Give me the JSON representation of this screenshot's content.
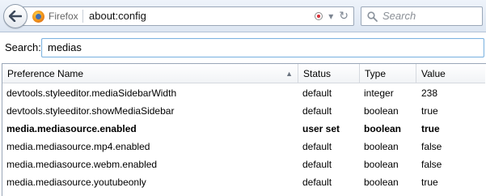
{
  "browser": {
    "identity_label": "Firefox",
    "url": "about:config",
    "search_placeholder": "Search"
  },
  "filter": {
    "label": "Search:",
    "value": "medias"
  },
  "table": {
    "columns": [
      "Preference Name",
      "Status",
      "Type",
      "Value"
    ],
    "sorted_column": "Preference Name",
    "sort_direction": "ascending",
    "rows": [
      {
        "name": "devtools.styleeditor.mediaSidebarWidth",
        "status": "default",
        "type": "integer",
        "value": "238",
        "modified": false
      },
      {
        "name": "devtools.styleeditor.showMediaSidebar",
        "status": "default",
        "type": "boolean",
        "value": "true",
        "modified": false
      },
      {
        "name": "media.mediasource.enabled",
        "status": "user set",
        "type": "boolean",
        "value": "true",
        "modified": true
      },
      {
        "name": "media.mediasource.mp4.enabled",
        "status": "default",
        "type": "boolean",
        "value": "false",
        "modified": false
      },
      {
        "name": "media.mediasource.webm.enabled",
        "status": "default",
        "type": "boolean",
        "value": "false",
        "modified": false
      },
      {
        "name": "media.mediasource.youtubeonly",
        "status": "default",
        "type": "boolean",
        "value": "true",
        "modified": false
      }
    ]
  },
  "icons": {
    "back": "back-arrow-icon",
    "firefox": "firefox-logo-icon",
    "record": "record-icon",
    "dropdown": "url-dropdown-icon",
    "reload": "reload-icon",
    "search": "search-icon",
    "sort": "sort-ascending-icon"
  },
  "colors": {
    "toolbar_top": "#eef3fa",
    "toolbar_bottom": "#dde6f2",
    "focus_border": "#7fb4e0"
  }
}
